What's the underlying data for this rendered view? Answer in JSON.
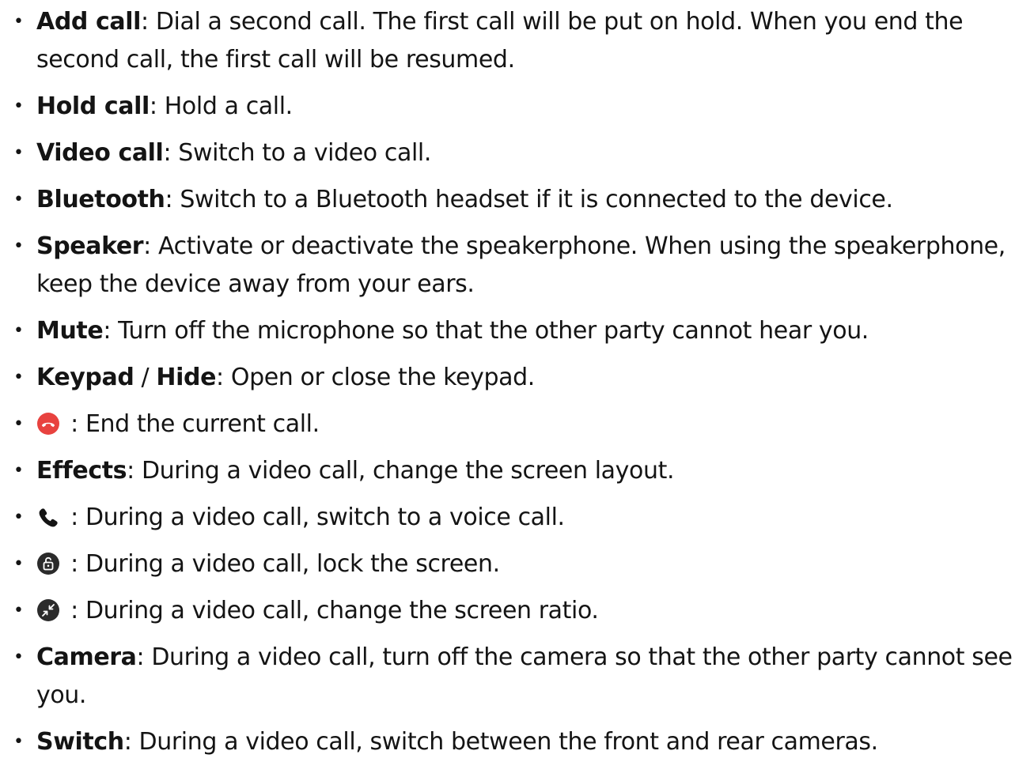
{
  "items": [
    {
      "term": "Add call",
      "desc": ": Dial a second call. The first call will be put on hold. When you end the second call, the first call will be resumed."
    },
    {
      "term": "Hold call",
      "desc": ": Hold a call."
    },
    {
      "term": "Video call",
      "desc": ": Switch to a video call."
    },
    {
      "term": "Bluetooth",
      "desc": ": Switch to a Bluetooth headset if it is connected to the device."
    },
    {
      "term": "Speaker",
      "desc": ": Activate or deactivate the speakerphone. When using the speakerphone, keep the device away from your ears."
    },
    {
      "term": "Mute",
      "desc": ": Turn off the microphone so that the other party cannot hear you."
    },
    {
      "term": "Keypad",
      "sep": " / ",
      "term2": "Hide",
      "desc": ": Open or close the keypad."
    },
    {
      "icon": "end-call-icon",
      "icon_color": "#e8423f",
      "desc": " : End the current call."
    },
    {
      "term": "Effects",
      "desc": ": During a video call, change the screen layout."
    },
    {
      "icon": "phone-icon",
      "desc": " : During a video call, switch to a voice call."
    },
    {
      "icon": "lock-icon",
      "desc": " : During a video call, lock the screen."
    },
    {
      "icon": "screen-ratio-icon",
      "desc": " : During a video call, change the screen ratio."
    },
    {
      "term": "Camera",
      "desc": ": During a video call, turn off the camera so that the other party cannot see you."
    },
    {
      "term": "Switch",
      "desc": ": During a video call, switch between the front and rear cameras."
    }
  ],
  "bullet": "•"
}
